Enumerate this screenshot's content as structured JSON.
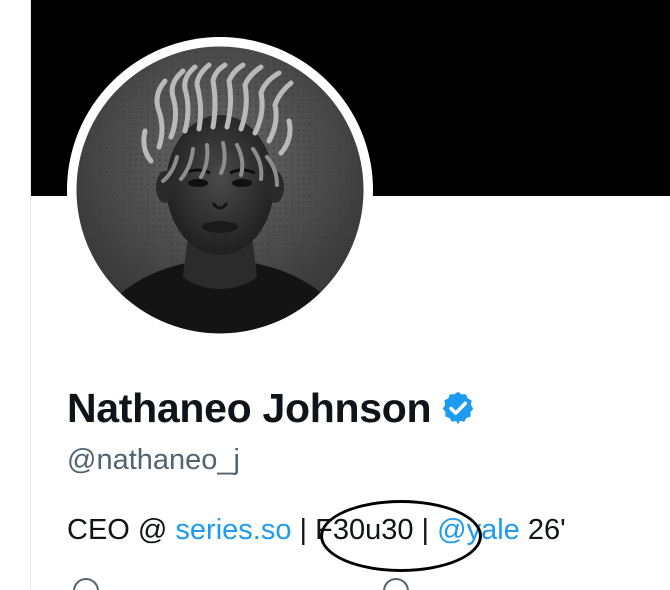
{
  "profile": {
    "display_name": "Nathaneo Johnson",
    "handle": "@nathaneo_j",
    "verified": true,
    "bio": {
      "part1": "CEO @ ",
      "link1": "series.so",
      "sep1": " | ",
      "highlight": "F30u30",
      "sep2": " | ",
      "link2": "@yale",
      "part2": " 26'"
    }
  },
  "icons": {
    "verified": "verified-badge-icon",
    "location": "location-icon",
    "link": "link-icon"
  },
  "colors": {
    "banner": "#000000",
    "text": "#0f1419",
    "secondary": "#536471",
    "link": "#1d9bf0",
    "verified": "#1d9bf0"
  }
}
